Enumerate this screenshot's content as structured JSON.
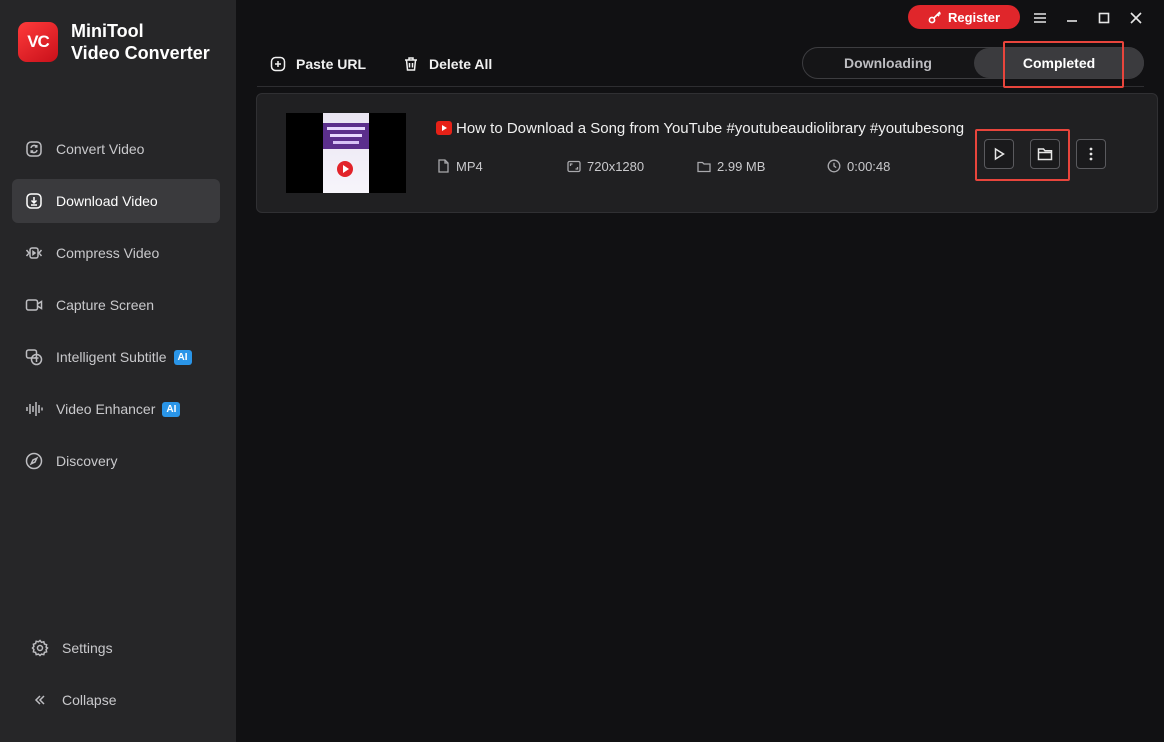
{
  "app": {
    "logo_text": "VC",
    "name_line1": "MiniTool",
    "name_line2": "Video Converter"
  },
  "titlebar": {
    "register_label": "Register",
    "menu_icon": "hamburger-icon",
    "minimize_icon": "minimize-icon",
    "maximize_icon": "maximize-icon",
    "close_icon": "close-icon",
    "register_color": "#e0262b"
  },
  "sidebar": {
    "items": [
      {
        "label": "Convert Video",
        "icon": "convert-icon",
        "active": false
      },
      {
        "label": "Download Video",
        "icon": "download-icon",
        "active": true
      },
      {
        "label": "Compress Video",
        "icon": "compress-icon",
        "active": false
      },
      {
        "label": "Capture Screen",
        "icon": "camera-icon",
        "active": false
      },
      {
        "label": "Intelligent Subtitle",
        "icon": "subtitle-icon",
        "active": false,
        "badge": "AI"
      },
      {
        "label": "Video Enhancer",
        "icon": "enhancer-icon",
        "active": false,
        "badge": "AI"
      },
      {
        "label": "Discovery",
        "icon": "compass-icon",
        "active": false
      }
    ],
    "bottom": {
      "settings_label": "Settings",
      "collapse_label": "Collapse"
    }
  },
  "toolbar": {
    "paste_url_label": "Paste URL",
    "delete_all_label": "Delete All"
  },
  "tabs": {
    "downloading_label": "Downloading",
    "completed_label": "Completed",
    "selected": "Completed"
  },
  "download_item": {
    "source_icon": "youtube-icon",
    "title": "How to Download a Song from YouTube #youtubeaudiolibrary #youtubesong",
    "format": "MP4",
    "resolution": "720x1280",
    "size": "2.99 MB",
    "duration": "0:00:48",
    "actions": [
      "play-icon",
      "folder-icon",
      "more-icon"
    ]
  },
  "colors": {
    "accent": "#e0262b",
    "highlight": "#e8453c",
    "ai_badge": "#2a95e8"
  }
}
